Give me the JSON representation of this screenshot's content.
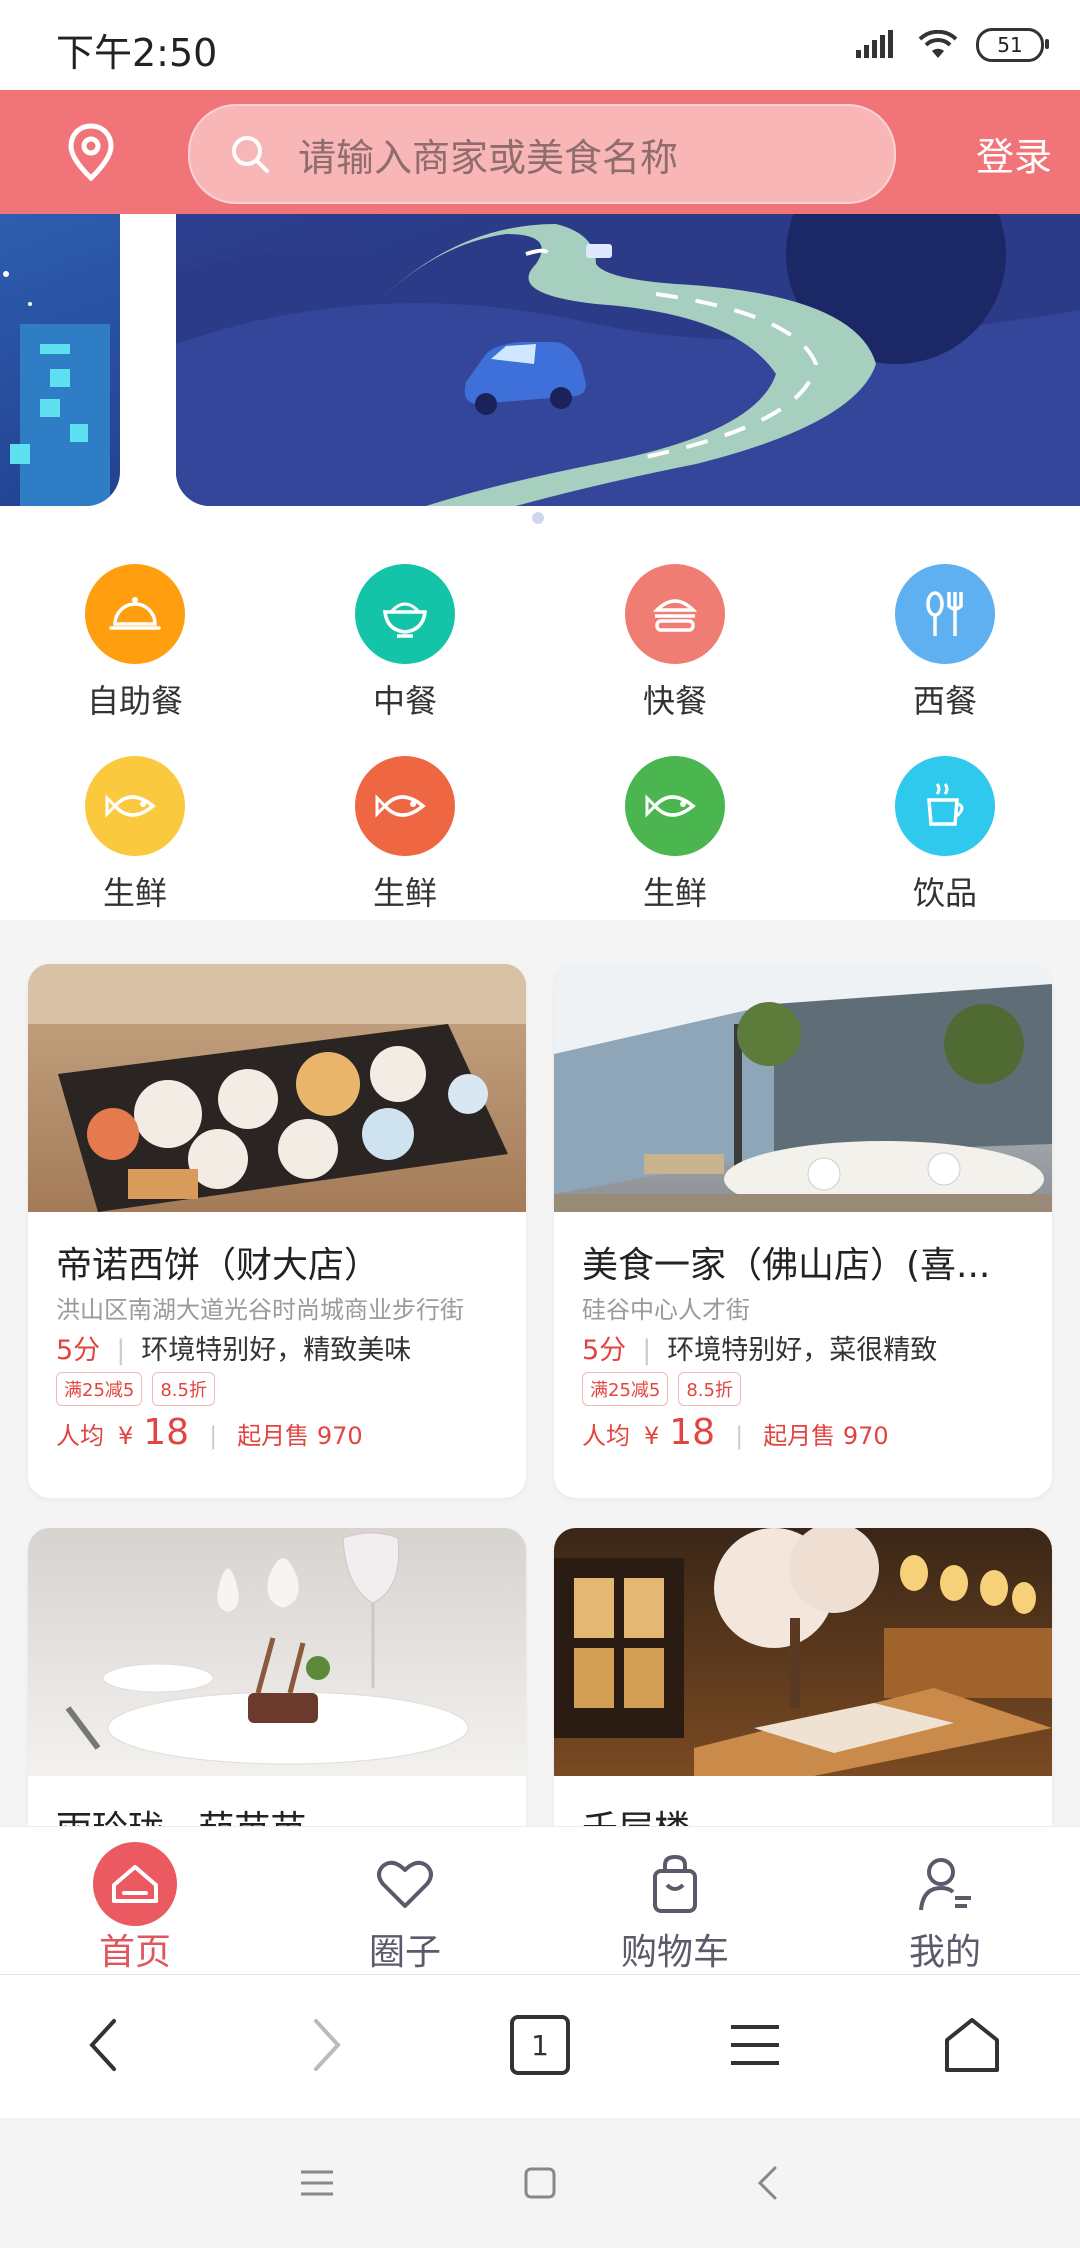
{
  "status_bar": {
    "time": "下午2:50",
    "battery": "51"
  },
  "header": {
    "search_placeholder": "请输入商家或美食名称",
    "login_label": "登录"
  },
  "categories": [
    {
      "label": "自助餐",
      "color": "#ff9f0f",
      "icon": "cloche-icon"
    },
    {
      "label": "中餐",
      "color": "#14c4a8",
      "icon": "rice-bowl-icon"
    },
    {
      "label": "快餐",
      "color": "#f07d73",
      "icon": "burger-icon"
    },
    {
      "label": "西餐",
      "color": "#5eb0f0",
      "icon": "spoon-fork-icon"
    },
    {
      "label": "生鲜",
      "color": "#fbc93d",
      "icon": "fish-icon"
    },
    {
      "label": "生鲜",
      "color": "#ef6742",
      "icon": "fish-icon"
    },
    {
      "label": "生鲜",
      "color": "#4bb54f",
      "icon": "fish-icon"
    },
    {
      "label": "饮品",
      "color": "#2ec9ec",
      "icon": "coffee-cup-icon"
    }
  ],
  "restaurants": [
    {
      "name": "帝诺西饼（财大店）",
      "address": "洪山区南湖大道光谷时尚城商业步行街",
      "score": "5分",
      "review": "环境特别好，精致美味",
      "tags": [
        "满25减5",
        "8.5折"
      ],
      "per_person_label": "人均",
      "currency": "¥",
      "price": "18",
      "monthly_sales": "起月售 970"
    },
    {
      "name": "美食一家（佛山店）(喜...",
      "address": "硅谷中心人才街",
      "score": "5分",
      "review": "环境特别好，菜很精致",
      "tags": [
        "满25减5",
        "8.5折"
      ],
      "per_person_label": "人均",
      "currency": "¥",
      "price": "18",
      "monthly_sales": "起月售 970"
    },
    {
      "name": "雨玲珑 · 茄苗苗"
    },
    {
      "name": "千层楼"
    }
  ],
  "tabbar": [
    {
      "label": "首页",
      "icon": "home-icon",
      "active": true
    },
    {
      "label": "圈子",
      "icon": "heart-icon",
      "active": false
    },
    {
      "label": "购物车",
      "icon": "shopping-bag-icon",
      "active": false
    },
    {
      "label": "我的",
      "icon": "user-icon",
      "active": false
    }
  ],
  "browser": {
    "tab_count": "1"
  },
  "colors": {
    "brand": "#f17479",
    "accent_red": "#e2443f"
  }
}
